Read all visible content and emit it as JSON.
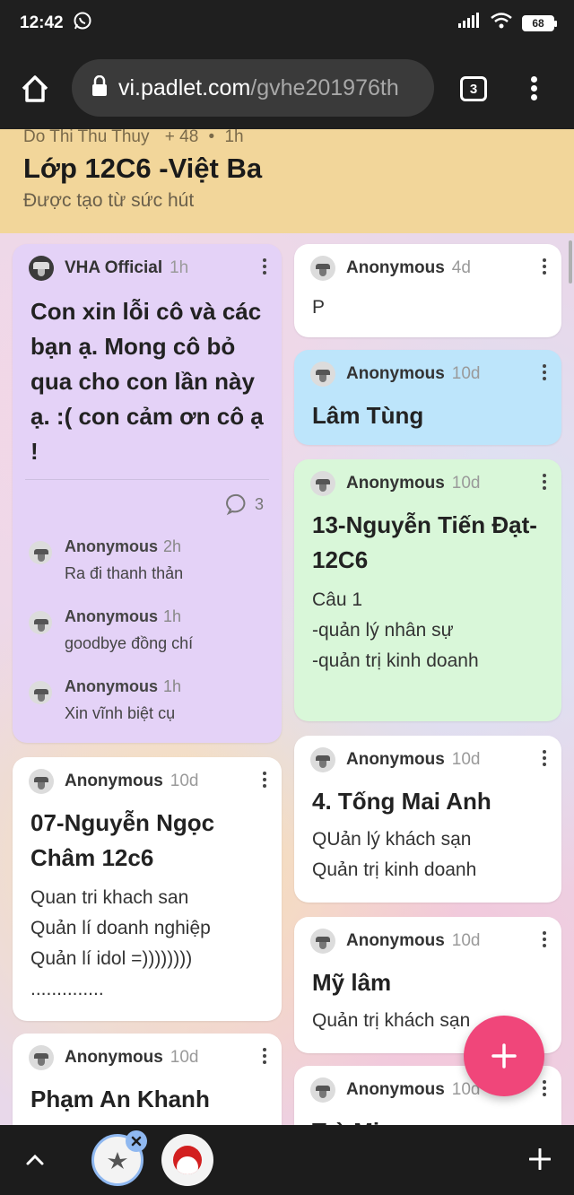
{
  "status": {
    "time": "12:42",
    "battery": "68"
  },
  "browser": {
    "url_host": "vi.padlet.com",
    "url_path": "/gvhe201976th",
    "tab_count": "3"
  },
  "padlet": {
    "owner": "Do Thi Thu Thuy",
    "plus": "+ 48",
    "dot": "•",
    "age": "1h",
    "title": "Lớp 12C6 -Việt Ba",
    "subtitle": "Được tạo từ sức hút"
  },
  "posts": {
    "p1": {
      "author": "VHA Official",
      "age": "1h",
      "title": "Con xin lỗi cô và các bạn ạ. Mong cô bỏ qua cho con lần này ạ. :( con cảm ơn cô ạ !",
      "comment_count": "3",
      "comments": [
        {
          "author": "Anonymous",
          "age": "2h",
          "body": "Ra đi thanh thản"
        },
        {
          "author": "Anonymous",
          "age": "1h",
          "body": "goodbye đồng chí"
        },
        {
          "author": "Anonymous",
          "age": "1h",
          "body": "Xin vĩnh biệt cụ"
        }
      ]
    },
    "p2": {
      "author": "Anonymous",
      "age": "10d",
      "title": "07-Nguyễn Ngọc Châm 12c6",
      "body": "Quan tri khach san\nQuản lí doanh nghiệp\nQuản lí idol =))))))))\n.............."
    },
    "p3": {
      "author": "Anonymous",
      "age": "10d",
      "title": "Phạm An Khanh"
    },
    "p4": {
      "author": "Anonymous",
      "age": "4d",
      "body": "P"
    },
    "p5": {
      "author": "Anonymous",
      "age": "10d",
      "title": "Lâm Tùng"
    },
    "p6": {
      "author": "Anonymous",
      "age": "10d",
      "title": "13-Nguyễn Tiến Đạt-12C6",
      "body": "Câu 1\n-quản lý nhân sự\n-quản trị kinh doanh"
    },
    "p7": {
      "author": "Anonymous",
      "age": "10d",
      "title": "4. Tống Mai Anh",
      "body": "QUản lý khách sạn\nQuản trị kinh doanh"
    },
    "p8": {
      "author": "Anonymous",
      "age": "10d",
      "title": "Mỹ lâm",
      "body": "Quản trị khách sạn"
    },
    "p9": {
      "author": "Anonymous",
      "age": "10d",
      "title": "Trà Mi"
    }
  },
  "colors": {
    "header": "#f2d69a",
    "purple": "#e4d2f7",
    "blue": "#bde5fb",
    "green": "#d9f7d9",
    "fab": "#f0467a"
  }
}
